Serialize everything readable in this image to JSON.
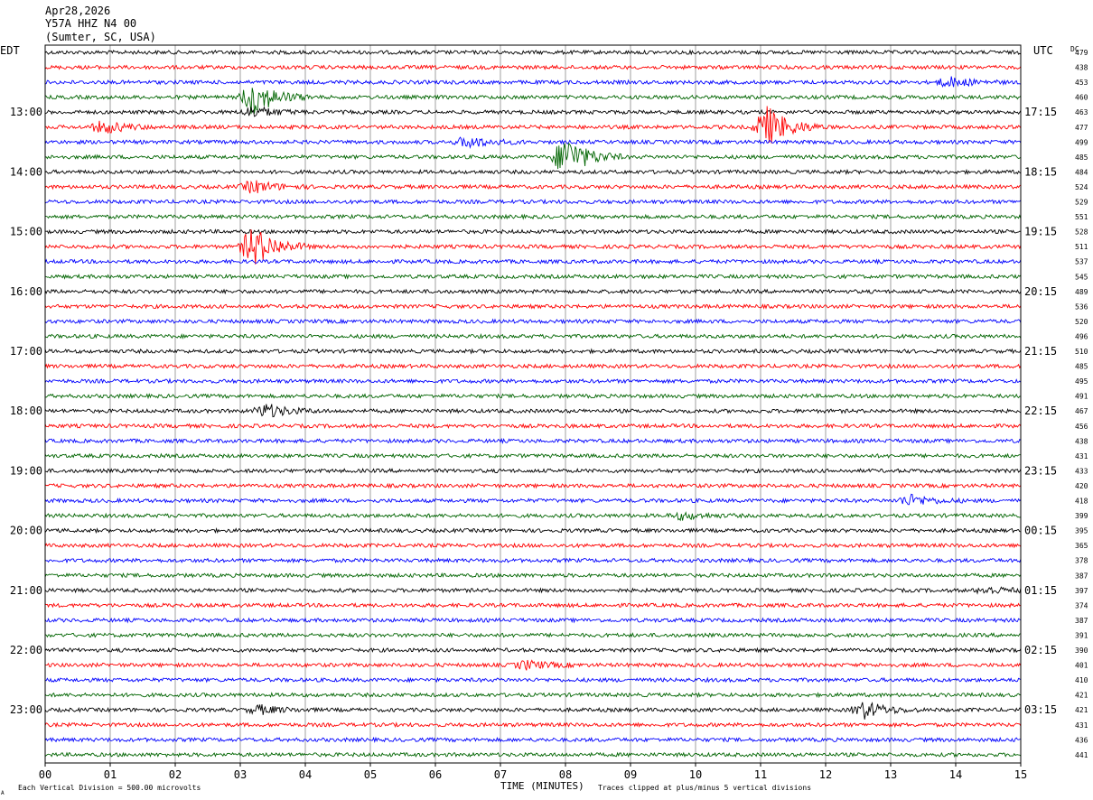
{
  "header": {
    "date": "Apr28,2026",
    "station": "Y57A HHZ N4 00",
    "location": "(Sumter, SC, USA)",
    "left_tz": "EDT",
    "right_tz": "UTC",
    "dc_label": "DC"
  },
  "footer": {
    "scale_note": "Each Vertical Division =  500.00 microvolts",
    "xlabel": "TIME (MINUTES)",
    "clip_note": "Traces clipped at plus/minus 5 vertical divisions",
    "corner_mark": "A"
  },
  "colors": {
    "cycle": [
      "#000000",
      "#ff0000",
      "#0000ff",
      "#006400"
    ],
    "grid": "#888888",
    "frame": "#000000"
  },
  "chart_data": {
    "type": "line",
    "title": "Y57A HHZ N4 00",
    "xlabel": "TIME (MINUTES)",
    "xlim": [
      0,
      15
    ],
    "x_ticks": [
      "00",
      "01",
      "02",
      "03",
      "04",
      "05",
      "06",
      "07",
      "08",
      "09",
      "10",
      "11",
      "12",
      "13",
      "14",
      "15"
    ],
    "rows_per_hour": 4,
    "minutes_per_row": 15,
    "left_hour_labels": [
      "13:00",
      "14:00",
      "15:00",
      "16:00",
      "17:00",
      "18:00",
      "19:00",
      "20:00",
      "21:00",
      "22:00",
      "23:00"
    ],
    "right_hour_labels": [
      "17:15",
      "18:15",
      "19:15",
      "20:15",
      "21:15",
      "22:15",
      "23:15",
      "00:15",
      "01:15",
      "02:15",
      "03:15"
    ],
    "dc_offsets": [
      479,
      438,
      453,
      460,
      463,
      477,
      499,
      485,
      484,
      524,
      529,
      551,
      528,
      511,
      537,
      545,
      489,
      536,
      520,
      496,
      510,
      485,
      495,
      491,
      467,
      456,
      438,
      431,
      433,
      420,
      418,
      399,
      395,
      365,
      378,
      387,
      397,
      374,
      387,
      391,
      390,
      401,
      410,
      421,
      421,
      431,
      436,
      441
    ],
    "events": [
      {
        "row": 3,
        "minute": 3.2,
        "amplitude": 2.6
      },
      {
        "row": 2,
        "minute": 13.9,
        "amplitude": 0.7
      },
      {
        "row": 4,
        "minute": 3.2,
        "amplitude": 0.8
      },
      {
        "row": 5,
        "minute": 0.9,
        "amplitude": 0.9
      },
      {
        "row": 5,
        "minute": 11.1,
        "amplitude": 3.0
      },
      {
        "row": 6,
        "minute": 6.5,
        "amplitude": 0.8
      },
      {
        "row": 7,
        "minute": 8.0,
        "amplitude": 3.0
      },
      {
        "row": 9,
        "minute": 3.2,
        "amplitude": 0.9
      },
      {
        "row": 13,
        "minute": 3.2,
        "amplitude": 3.0
      },
      {
        "row": 24,
        "minute": 3.4,
        "amplitude": 1.0
      },
      {
        "row": 30,
        "minute": 13.3,
        "amplitude": 0.8
      },
      {
        "row": 31,
        "minute": 9.8,
        "amplitude": 0.5
      },
      {
        "row": 36,
        "minute": 14.5,
        "amplitude": 0.5
      },
      {
        "row": 41,
        "minute": 7.4,
        "amplitude": 0.6
      },
      {
        "row": 44,
        "minute": 3.3,
        "amplitude": 0.6
      },
      {
        "row": 44,
        "minute": 12.6,
        "amplitude": 1.2
      }
    ]
  }
}
